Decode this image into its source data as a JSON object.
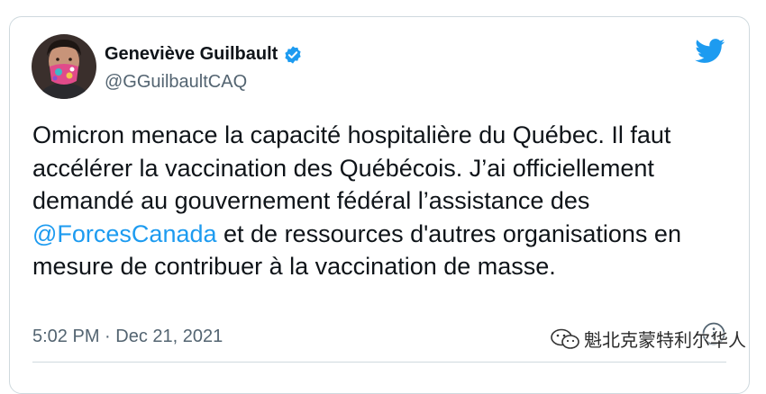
{
  "tweet": {
    "author_name": "Geneviève Guilbault",
    "author_handle": "@GGuilbaultCAQ",
    "text_part1": "Omicron menace la capacité hospitalière du Québec. Il faut accélérer la vaccination des Québécois. J’ai officiellement demandé au gouvernement fédéral l’assistance des ",
    "mention": "@ForcesCanada",
    "text_part2": " et de ressources d'autres organisations en mesure de contribuer à la vaccination de masse.",
    "timestamp": "5:02 PM · Dec 21, 2021"
  },
  "watermark": {
    "text": "魁北克蒙特利尔华人"
  },
  "icons": {
    "verified": "verified-badge-icon",
    "brand": "twitter-bird-icon",
    "info": "info-icon",
    "watermark": "wechat-icon"
  },
  "colors": {
    "accent": "#1d9bf0",
    "text": "#0f1419",
    "secondary": "#536471"
  }
}
